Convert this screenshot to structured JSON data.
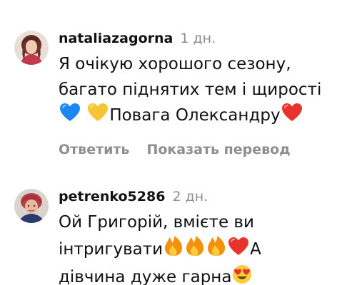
{
  "comments": [
    {
      "username": "nataliazagorna",
      "time": "1 дн.",
      "lines": [
        "Я очікую хорошого сезону,",
        "багато піднятих тем і щирості"
      ],
      "line3_text": "Повага Олександру",
      "emoji_before": [
        "blue-heart",
        "yellow-heart"
      ],
      "emoji_after": [
        "red-heart"
      ],
      "reply_label": "Ответить",
      "translate_label": "Показать перевод"
    },
    {
      "username": "petrenko5286",
      "time": "2 дн.",
      "line1": "Ой  Григорій, вмієте ви",
      "line2_text_before": "інтригувати",
      "line2_emoji": [
        "fire",
        "fire",
        "fire",
        "red-heart"
      ],
      "line2_text_after": "А",
      "line3_text": "дівчина дуже гарна",
      "line3_emoji": [
        "heart-eyes-face"
      ]
    }
  ],
  "colors": {
    "username": "#111111",
    "meta_gray": "#8e8e8e",
    "blue_heart": "#1c86f2",
    "yellow_heart": "#f7c534",
    "red_heart": "#e8322c",
    "fire_orange": "#f4900c",
    "face_yellow": "#ffcc3e"
  }
}
